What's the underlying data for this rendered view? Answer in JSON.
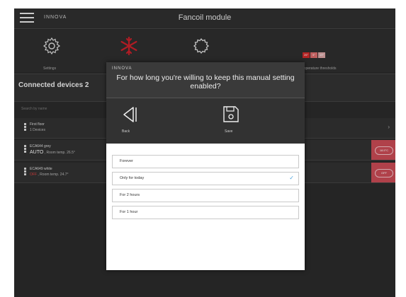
{
  "header": {
    "brand": "INNOVA",
    "title": "Fancoil module"
  },
  "toolbar": {
    "settings_label": "Settings",
    "thresholds_label": "Temperature thresholds",
    "thresholds": [
      {
        "text": "26°",
        "color": "#cc2a2a"
      },
      {
        "text": "5°",
        "color": "#d96a6a"
      },
      {
        "text": "19°",
        "color": "#d9a4a4"
      }
    ],
    "mode_color": "#c8202a"
  },
  "devices": {
    "title": "Connected devices 2",
    "search_placeholder": "Search by name",
    "floor": {
      "name": "First floor",
      "count": "1 Devices"
    },
    "items": [
      {
        "name": "ECA644 grey",
        "mode": "AUTO",
        "room": "Room temp. 26.5°",
        "badge": "18.5°C"
      },
      {
        "name": "ECA649 white",
        "mode": "OFF",
        "room": "Room temp. 24.7°",
        "badge": "OFF"
      }
    ],
    "off_color": "#e04040",
    "badge_color": "#c94a55"
  },
  "modal": {
    "brand": "INNOVA",
    "question": "For how long you're willing to keep this manual setting enabled?",
    "back_label": "Back",
    "save_label": "Save",
    "options": [
      {
        "label": "Forever",
        "selected": false
      },
      {
        "label": "Only for today",
        "selected": true
      },
      {
        "label": "For 2 hours",
        "selected": false
      },
      {
        "label": "For 1 hour",
        "selected": false
      }
    ],
    "check_color": "#4ca3dd"
  }
}
